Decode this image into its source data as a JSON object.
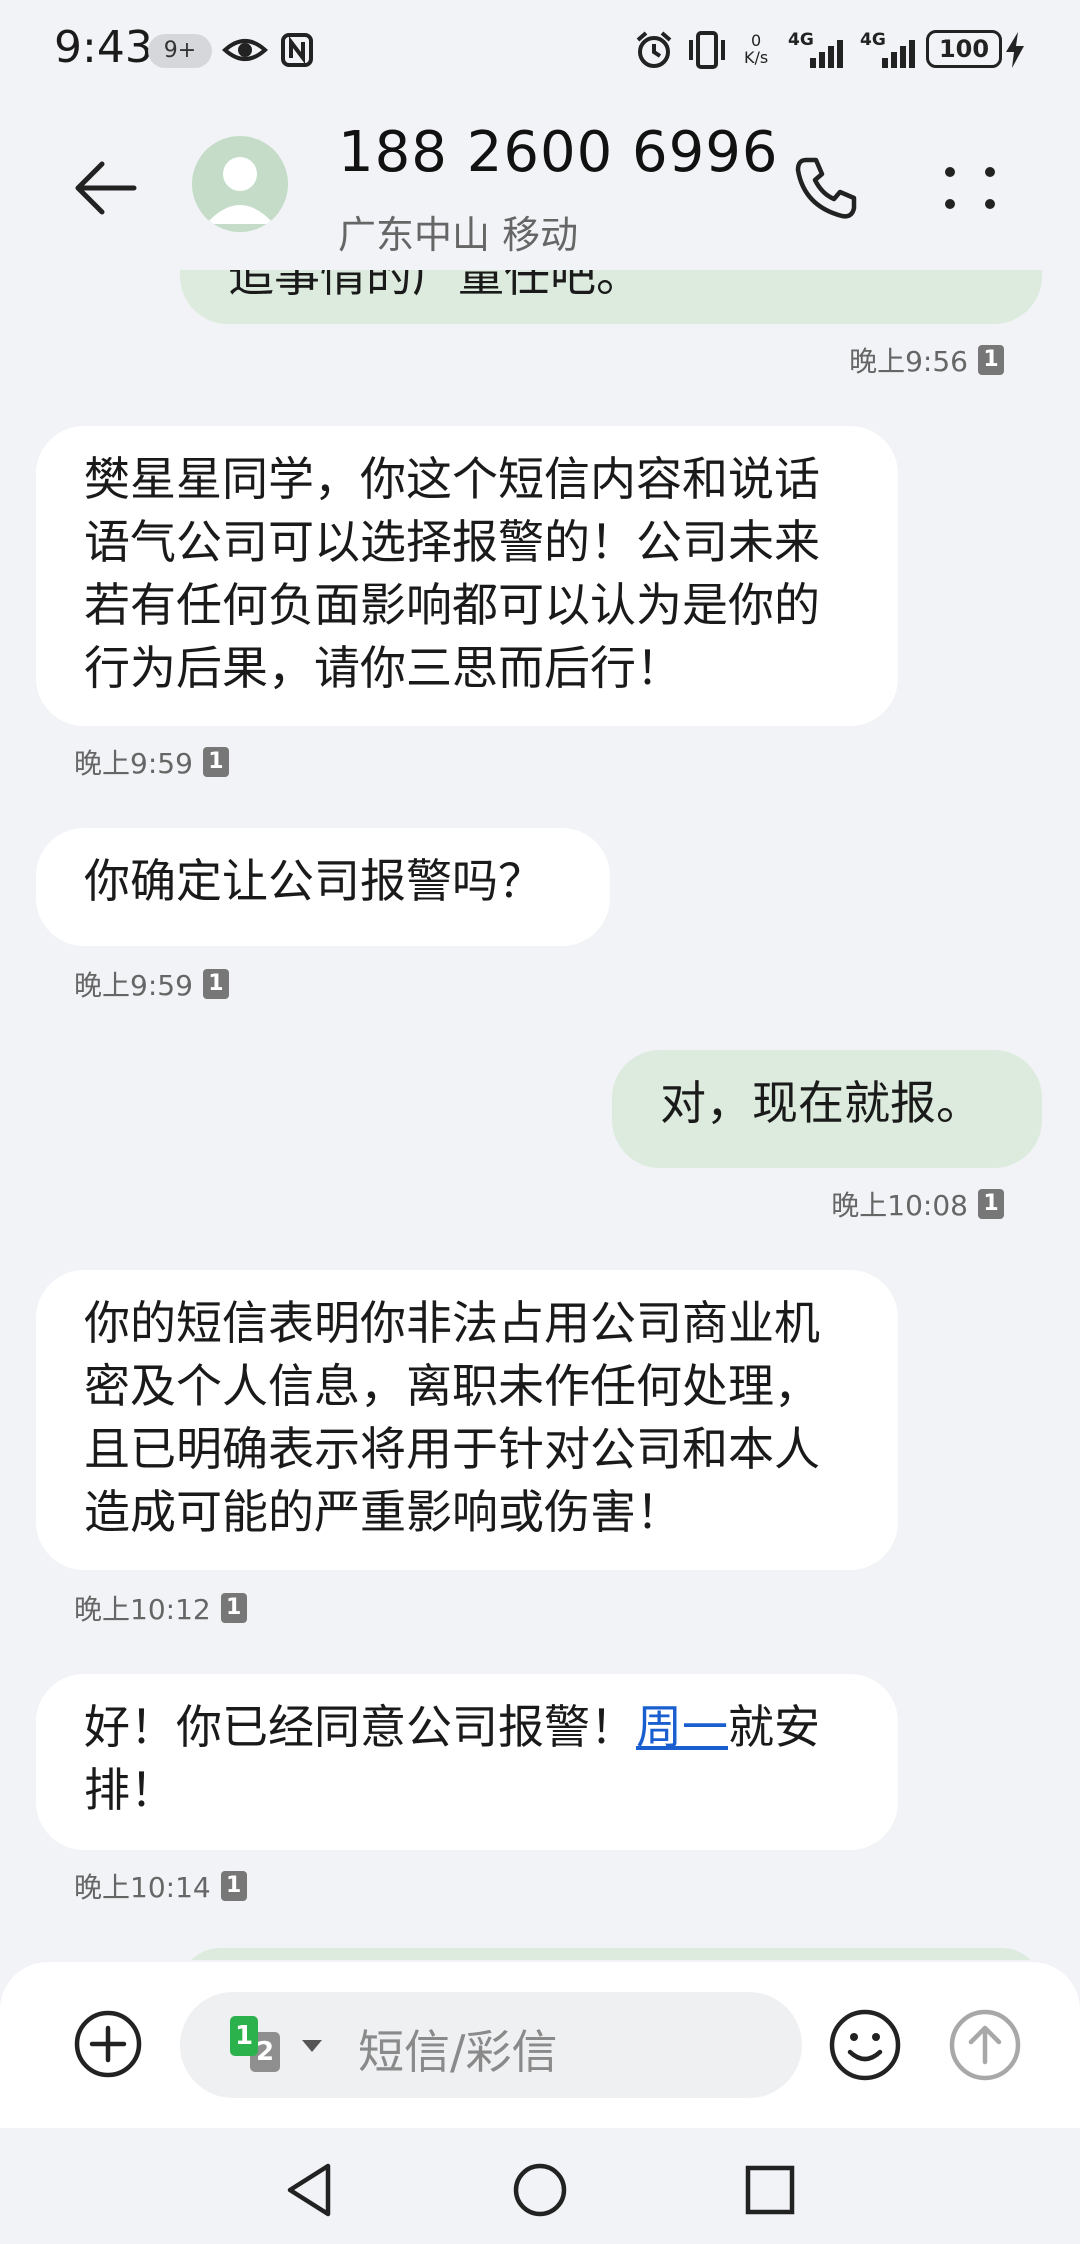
{
  "status_bar": {
    "time": "9:43",
    "badge": "9+",
    "net_speed_value": "0",
    "net_speed_unit": "K/s",
    "signal1_label": "4G",
    "signal2_label": "4G",
    "battery": "100",
    "icons": [
      "eye-icon",
      "nfc-icon",
      "alarm-icon",
      "vibrate-icon",
      "signal-icon",
      "signal-icon",
      "battery-icon",
      "charging-icon"
    ]
  },
  "header": {
    "contact_number": "188 2600 6996",
    "contact_location": "广东中山 移动",
    "icons": [
      "back-arrow-icon",
      "avatar-icon",
      "phone-icon",
      "more-icon"
    ]
  },
  "messages": [
    {
      "direction": "sent",
      "text": "追事情的广量任吧。",
      "partial": true
    },
    {
      "direction": "meta",
      "time": "晚上9:56",
      "sim": "1"
    },
    {
      "direction": "received",
      "lines": [
        "樊星星同学，你这个短信内容和说话",
        "语气公司可以选择报警的！公司未来",
        "若有任何负面影响都可以认为是你的",
        "行为后果，请你三思而后行！"
      ]
    },
    {
      "direction": "meta",
      "time": "晚上9:59",
      "sim": "1"
    },
    {
      "direction": "received",
      "lines": [
        "你确定让公司报警吗？"
      ]
    },
    {
      "direction": "meta",
      "time": "晚上9:59",
      "sim": "1"
    },
    {
      "direction": "sent",
      "lines": [
        "对，现在就报。"
      ]
    },
    {
      "direction": "meta",
      "time": "晚上10:08",
      "sim": "1"
    },
    {
      "direction": "received",
      "lines": [
        "你的短信表明你非法占用公司商业机",
        "密及个人信息，离职未作任何处理，",
        "且已明确表示将用于针对公司和本人",
        "造成可能的严重影响或伤害！"
      ]
    },
    {
      "direction": "meta",
      "time": "晚上10:12",
      "sim": "1"
    },
    {
      "direction": "received",
      "text_before_link": "好！你已经同意公司报警！",
      "link_text": "周一",
      "text_after_link": "就安",
      "line2": "排！"
    },
    {
      "direction": "meta",
      "time": "晚上10:14",
      "sim": "1"
    }
  ],
  "composer": {
    "placeholder": "短信/彩信",
    "sim_primary": "1",
    "sim_secondary": "2",
    "icons": [
      "add-icon",
      "sim-select-icon",
      "emoji-icon",
      "send-icon"
    ]
  },
  "nav_bar": {
    "icons": [
      "back-icon",
      "home-icon",
      "recents-icon"
    ]
  },
  "colors": {
    "background": "#f1f3f6",
    "received_bubble": "#ffffff",
    "sent_bubble": "#dcebdd",
    "link": "#1a5fd0",
    "sim_green": "#2bb24c"
  }
}
